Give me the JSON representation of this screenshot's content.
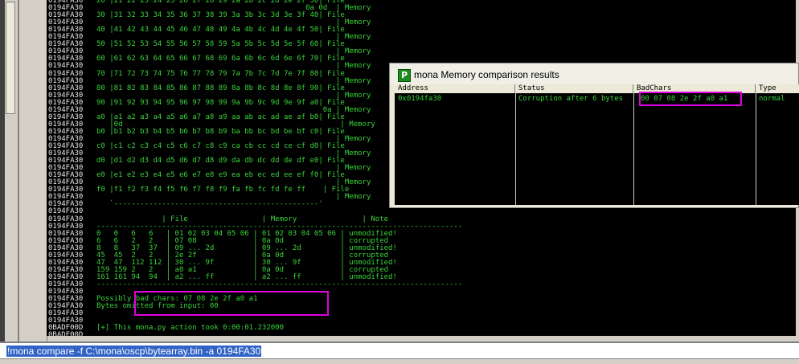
{
  "log": {
    "addresses": [
      "0194FA30",
      "0194FA30",
      "0194FA30",
      "0194FA30",
      "0194FA30",
      "0194FA30",
      "0194FA30",
      "0194FA30",
      "0194FA30",
      "0194FA30",
      "0194FA30",
      "0194FA30",
      "0194FA30",
      "0194FA30",
      "0194FA30",
      "0194FA30",
      "0194FA30",
      "0194FA30",
      "0194FA30",
      "0194FA30",
      "0194FA30",
      "0194FA30",
      "0194FA30",
      "0194FA30",
      "0194FA30",
      "0194FA30",
      "0194FA30",
      "0194FA30",
      "0194FA30",
      "0194FA30",
      "0194FA30",
      "0194FA30",
      "0194FA30",
      "0194FA30",
      "0194FA30",
      "0194FA30",
      "0194FA30",
      "0194FA30",
      "0194FA30",
      "0194FA30",
      "0194FA30",
      "0194FA30",
      "0194FA30",
      "0194FA30",
      "0194FA30",
      "0BADF00D",
      "0BADF00D"
    ],
    "dump_lines": [
      "20 |21 22 23 24 25 26 27 28 29 2a 2b 2c 2d 2e 2f 30| File",
      "                                                0a 0d  | Memory",
      "30 |31 32 33 34 35 36 37 38 39 3a 3b 3c 3d 3e 3f 40| File",
      "                                                       | Memory",
      "40 |41 42 43 44 45 46 47 48 49 4a 4b 4c 4d 4e 4f 50| File",
      "                                                       | Memory",
      "50 |51 52 53 54 55 56 57 58 59 5a 5b 5c 5d 5e 5f 60| File",
      "                                                       | Memory",
      "60 |61 62 63 64 65 66 67 68 69 6a 6b 6c 6d 6e 6f 70| File",
      "                                                       | Memory",
      "70 |71 72 73 74 75 76 77 78 79 7a 7b 7c 7d 7e 7f 80| File",
      "                                                       | Memory",
      "80 |81 82 83 84 85 86 87 88 89 8a 8b 8c 8d 8e 8f 90| File",
      "                                                       | Memory",
      "90 |91 92 93 94 95 96 97 98 99 9a 9b 9c 9d 9e 9f a0| File",
      "                                                    0a | Memory",
      "a0 |a1 a2 a3 a4 a5 a6 a7 a8 a9 aa ab ac ad ae af b0| File",
      "   |0d                                                  | Memory",
      "b0 |b1 b2 b3 b4 b5 b6 b7 b8 b9 ba bb bc bd be bf c0| File",
      "                                                       | Memory",
      "c0 |c1 c2 c3 c4 c5 c6 c7 c8 c9 ca cb cc cd ce cf d0| File",
      "                                                       | Memory",
      "d0 |d1 d2 d3 d4 d5 d6 d7 d8 d9 da db dc dd de df e0| File",
      "                                                       | Memory",
      "e0 |e1 e2 e3 e4 e5 e6 e7 e8 e9 ea eb ec ed ee ef f0| File",
      "                                                       | Memory",
      "f0 |f1 f2 f3 f4 f5 f6 f7 f8 f9 fa fb fc fd fe ff    | File",
      "                                                       | Memory",
      "   `-----------------------------------------------'",
      "",
      "               | File                 | Memory               | Note",
      "------------------------------------------------------------------------------------",
      "0   0   6   6   | 01 02 03 04 05 06 | 01 02 03 04 05 06 | unmodified!",
      "6   6   2   2   | 07 08             | 0a 0d             | corrupted",
      "8   8   37  37  | 09 ... 2d         | 09 ... 2d         | unmodified!",
      "45  45  2   2   | 2e 2f             | 0a 0d             | corrupted",
      "47  47  112 112 | 30 ... 9f         | 30 ... 9f         | unmodified!",
      "159 159 2   2   | a0 a1             | 0a 0d             | corrupted",
      "161 161 94  94  | a2 ... ff         | a2 ... ff         | unmodified!",
      "------------------------------------------------------------------------------------",
      "",
      "Possibly bad chars: 07 08 2e 2f a0 a1",
      "Bytes omitted from input: 00",
      "",
      "",
      "[+] This mona.py action took 0:00:01.232000"
    ]
  },
  "results_window": {
    "icon_letter": "P",
    "title": "mona Memory comparison results",
    "columns": [
      "Address",
      "Status",
      "BadChars",
      "Type"
    ],
    "rows": [
      {
        "address": "0x0194fa30",
        "status": "Corruption after 6 bytes",
        "badchars": "00 07 08 2e 2f a0 a1",
        "type": "normal"
      }
    ]
  },
  "command": {
    "value": "!mona compare -f C:\\mona\\oscp\\bytearray.bin -a 0194FA30"
  }
}
